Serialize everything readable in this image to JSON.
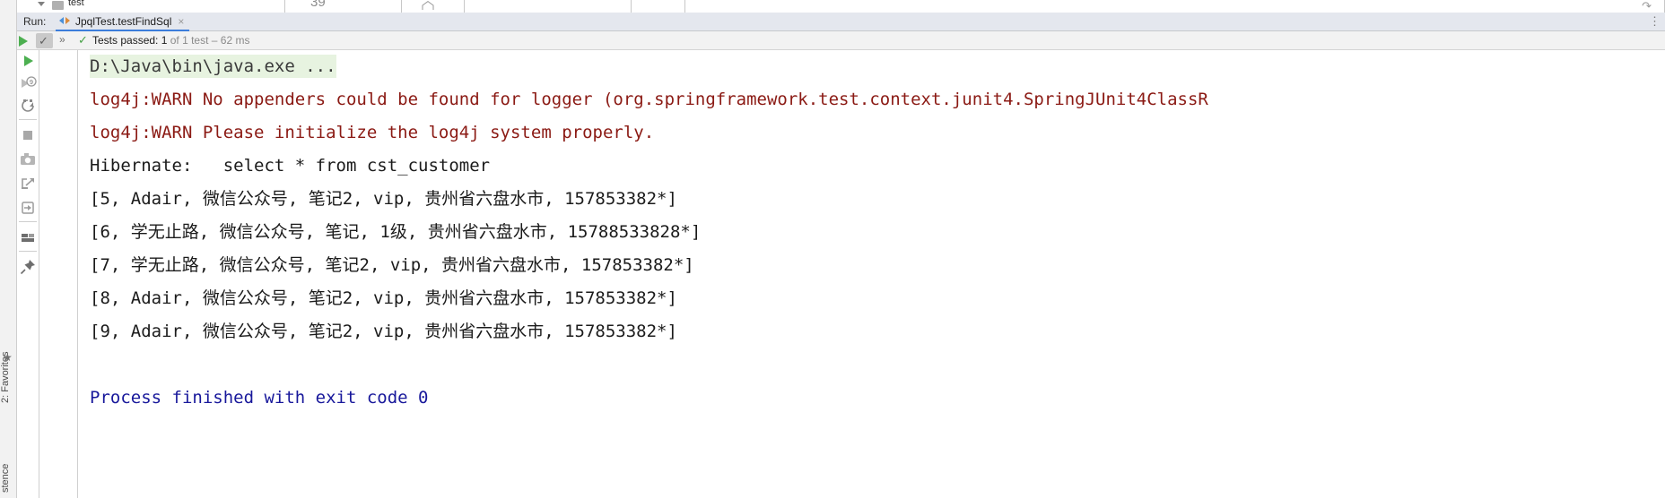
{
  "top_strip": {
    "tree_item_label": "test",
    "number_label": "39",
    "home_icon": "home-icon",
    "curve_icon": "curve-arrow-icon"
  },
  "run_window": {
    "label": "Run:",
    "tab": {
      "title": "JpqlTest.testFindSql",
      "icon": "run-configuration-icon",
      "close": "×"
    },
    "header_right": "⋮"
  },
  "status_bar": {
    "run_icon": "run-play-icon",
    "toggle_icon": "show-passed-toggle-icon",
    "expand_icon": "»",
    "result_check_icon": "check-icon",
    "result_prefix": "Tests passed: ",
    "result_count": "1",
    "result_suffix": " of 1 test – 62 ms"
  },
  "left_toolbar": {
    "items": [
      {
        "name": "rerun-icon",
        "label": "Rerun"
      },
      {
        "name": "rerun-failed-icon",
        "label": "Rerun Failed Tests"
      },
      {
        "name": "toggle-auto-test-icon",
        "label": "Toggle auto-test"
      },
      {
        "name": "stop-icon",
        "label": "Stop"
      },
      {
        "name": "export-snapshot-icon",
        "label": "Export Test Results"
      },
      {
        "name": "import-results-icon",
        "label": "Import Test Results"
      },
      {
        "name": "open-in-browser-icon",
        "label": "Open Source"
      },
      {
        "name": "layout-icon",
        "label": "Layout"
      },
      {
        "name": "pin-icon",
        "label": "Pin Tab"
      }
    ]
  },
  "gutter": {
    "collapse_icon": "collapse-triangle-icon",
    "status_icon": "test-passed-check-icon"
  },
  "console": {
    "lines": [
      {
        "type": "cmd",
        "text": "D:\\Java\\bin\\java.exe ..."
      },
      {
        "type": "warn",
        "text": "log4j:WARN No appenders could be found for logger (org.springframework.test.context.junit4.SpringJUnit4ClassR"
      },
      {
        "type": "warn",
        "text": "log4j:WARN Please initialize the log4j system properly."
      },
      {
        "type": "plain",
        "text": "Hibernate:   select * from cst_customer"
      },
      {
        "type": "plain",
        "text": "[5, Adair, 微信公众号, 笔记2, vip, 贵州省六盘水市, 157853382*]"
      },
      {
        "type": "plain",
        "text": "[6, 学无止路, 微信公众号, 笔记, 1级, 贵州省六盘水市, 15788533828*]"
      },
      {
        "type": "plain",
        "text": "[7, 学无止路, 微信公众号, 笔记2, vip, 贵州省六盘水市, 157853382*]"
      },
      {
        "type": "plain",
        "text": "[8, Adair, 微信公众号, 笔记2, vip, 贵州省六盘水市, 157853382*]"
      },
      {
        "type": "plain",
        "text": "[9, Adair, 微信公众号, 笔记2, vip, 贵州省六盘水市, 157853382*]"
      },
      {
        "type": "empty",
        "text": " "
      },
      {
        "type": "info",
        "text": "Process finished with exit code 0"
      }
    ]
  },
  "vertical_tool_windows": {
    "favorites": {
      "prefix": "2: ",
      "shortcut_letter": "F",
      "label": "2: Favorites",
      "star_icon": "star-icon"
    },
    "persistence": {
      "label": "stence"
    }
  },
  "colors": {
    "warn_text": "#8b1a14",
    "info_text": "#18189b",
    "cmd_highlight": "#e7f3e0",
    "tab_underline": "#3c7ddb",
    "selection": "#3d7bbf",
    "pass_green": "#46a146"
  }
}
